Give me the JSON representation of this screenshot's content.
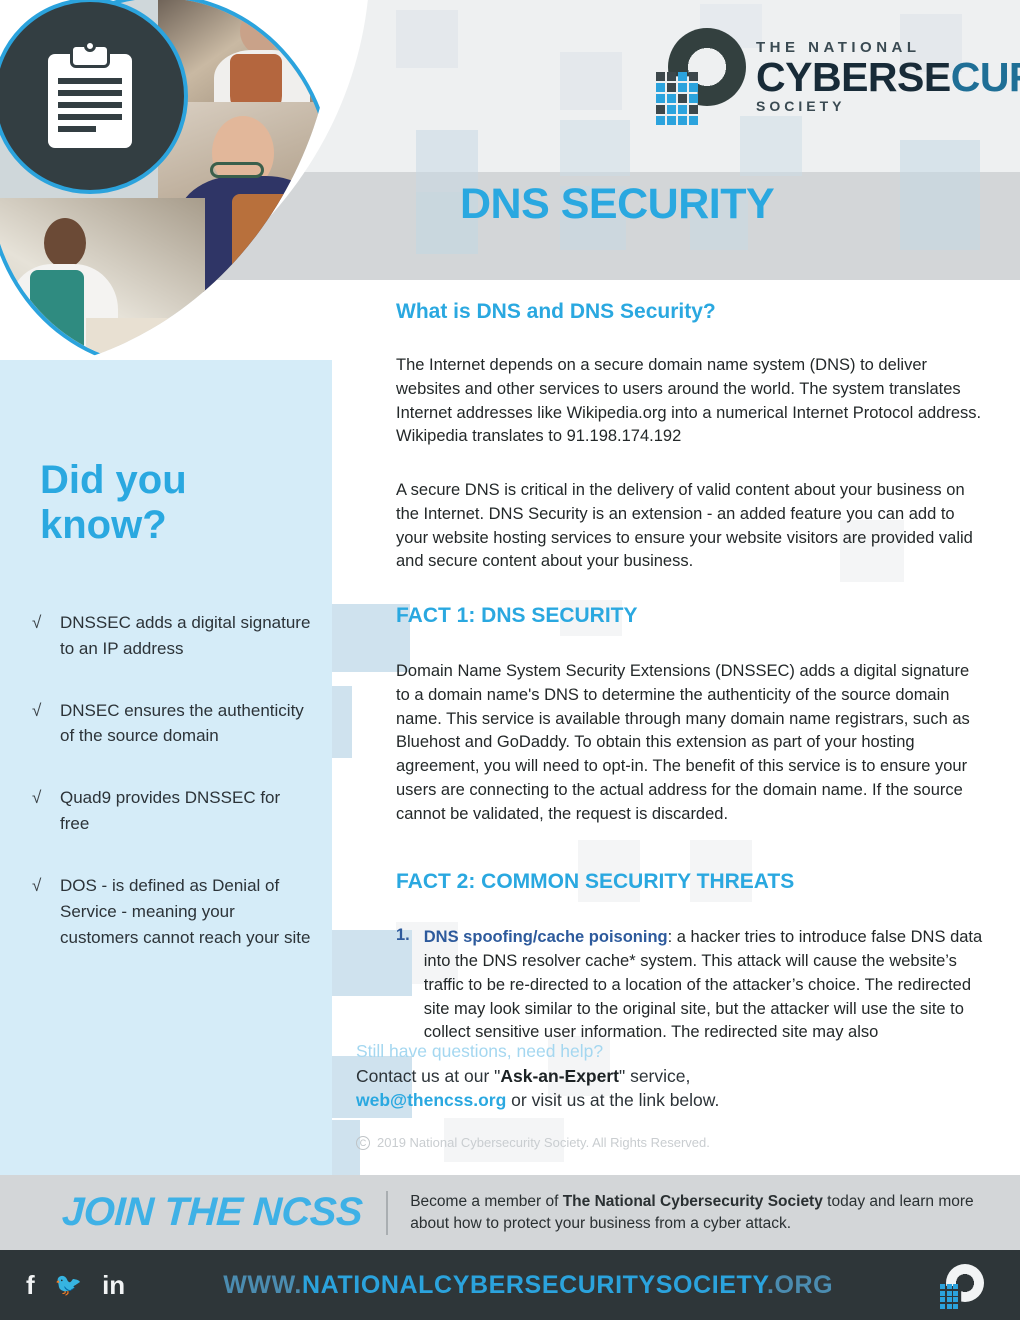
{
  "logo": {
    "line1": "THE NATIONAL",
    "line2_a": "CYBERSE",
    "line2_b": "CURITY",
    "line3": "SOCIETY"
  },
  "header": {
    "title": "DNS SECURITY"
  },
  "sidebar": {
    "heading": "Did you know?",
    "check_glyph": "√",
    "facts": [
      "DNSSEC adds a digital signature to an IP address",
      "DNSEC ensures the authenticity of the source domain",
      "Quad9 provides DNSSEC for free",
      "DOS - is defined as Denial of Service - meaning your customers cannot reach your site"
    ]
  },
  "main": {
    "intro_heading": "What is DNS and DNS Security?",
    "intro_p1": "The Internet depends on a secure domain name system (DNS) to deliver websites and other services to users around the world. The system translates Internet addresses like Wikipedia.org into a numerical Internet Protocol address. Wikipedia translates to 91.198.174.192",
    "intro_p2": "A secure DNS is critical in the delivery of valid content about your business on the Internet. DNS Security is an extension - an added feature you can add to your website hosting services to ensure your website visitors are provided valid and secure content about your business.",
    "fact1_heading": "FACT 1: DNS SECURITY",
    "fact1_body": "Domain Name System Security Extensions (DNSSEC) adds a digital signature to a domain name's DNS to determine the authenticity of the source domain name. This service is available through many domain name registrars, such as Bluehost and GoDaddy. To obtain this extension as part of your hosting agreement, you will need to opt-in. The benefit of this service is to ensure your users are connecting to the actual address for the domain name. If the source cannot be validated, the request is discarded.",
    "fact2_heading": "FACT 2: COMMON SECURITY THREATS",
    "threat1_number": "1.",
    "threat1_term": "DNS spoofing/cache poisoning",
    "threat1_body": ": a hacker tries to introduce false DNS data into the DNS resolver cache* system. This attack will cause the website’s traffic to be re-directed to a location of the attacker’s choice. The redirected site may look similar to the original site, but the attacker will use the site to collect sensitive user information. The redirected site may also"
  },
  "contact": {
    "question": "Still have questions, need help?",
    "line2_pre": "Contact us at our \"",
    "line2_bold": "Ask-an-Expert",
    "line2_post": "\" service,",
    "email": "web@thencss.org",
    "line3_post": " or visit us at the link below.",
    "copyright_mark": "C",
    "copyright": "2019 National Cybersecurity Society. All Rights Reserved."
  },
  "join": {
    "title": "JOIN THE NCSS",
    "copy_pre": "Become a member of ",
    "copy_bold": "The National Cybersecurity Society",
    "copy_post": " today and learn more about how to protect your business from a cyber attack."
  },
  "bottom": {
    "facebook": "f",
    "twitter": "🐦",
    "linkedin": "in",
    "url_www": "WWW.",
    "url_main": "NATIONALCYBERSECURITYSOCIETY",
    "url_tld": ".ORG"
  },
  "colors": {
    "accent_blue": "#2aa8e0",
    "sidebar_blue": "#d5ecf8",
    "navy": "#2d5a9c",
    "dark_bar": "#2e3639",
    "band_gray": "#d3d6d8"
  }
}
